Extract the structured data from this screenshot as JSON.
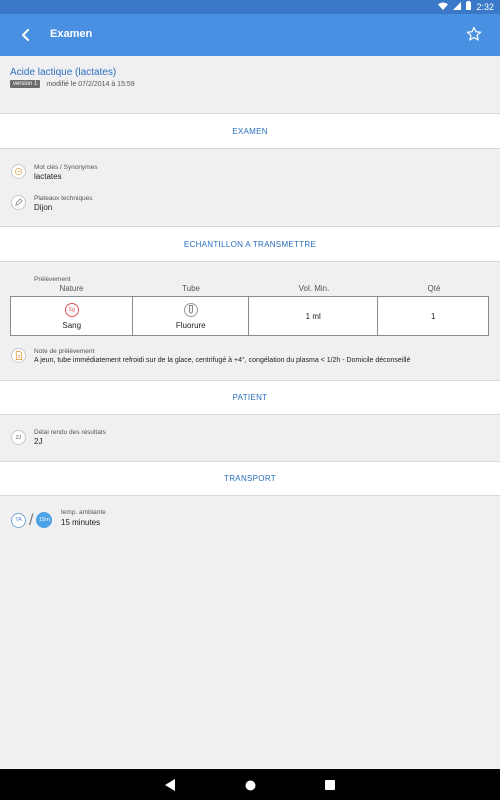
{
  "status_bar": {
    "time": "2:32"
  },
  "app_bar": {
    "title": "Examen"
  },
  "exam": {
    "name": "Acide lactique (lactates)",
    "version": "version 1",
    "modified": "modifié le  07/2/2014 à 15:59"
  },
  "sections": {
    "examen": "EXAMEN",
    "echantillon": "ECHANTILLON A TRANSMETTRE",
    "patient": "PATIENT",
    "transport": "TRANSPORT"
  },
  "examen": {
    "synonymes_label": "Mot clés / Synonymes",
    "synonymes_value": "lactates",
    "plateaux_label": "Plateaux techniques",
    "plateaux_value": "Dijon"
  },
  "prelevement": {
    "label": "Prélèvement",
    "headers": [
      "Nature",
      "Tube",
      "Vol. Min.",
      "Qté"
    ],
    "row": {
      "nature_badge": "Sg",
      "nature": "Sang",
      "tube": "Fluorure",
      "vol_min": "1 ml",
      "qte": "1"
    },
    "note_label": "Note de prélèvement",
    "note_value": "A jeun, tube immédiatement refroidi sur de la glace, centrifugé à +4°, congélation du plasma < 1/2h - Domicile déconseillé"
  },
  "patient": {
    "delai_badge": "2J",
    "delai_label": "Délai rendu des résultats",
    "delai_value": "2J"
  },
  "transport": {
    "temp_badge": "TA",
    "time_badge": "15m",
    "temp_label": "temp. ambiante",
    "time_value": "15 minutes"
  },
  "colors": {
    "app_bar": "#4a90e2",
    "accent": "#2a6fbd",
    "nature_red": "#e15555"
  },
  "icons": {
    "back": "arrow-left-icon",
    "favorite": "star-outline-icon",
    "synonymes": "keyword-icon",
    "plateaux": "pencil-icon",
    "tube": "tube-icon",
    "note": "document-icon"
  }
}
